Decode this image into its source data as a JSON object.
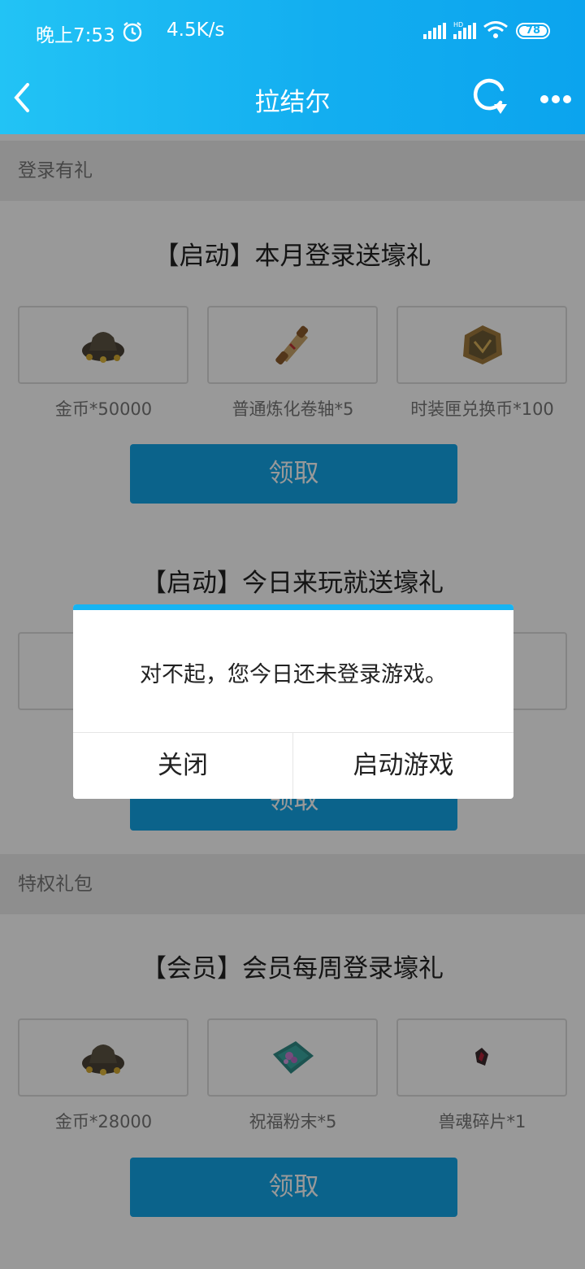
{
  "status_bar": {
    "time": "晚上7:53",
    "speed": "4.5K/s",
    "battery": "78",
    "icons": [
      "alarm-icon",
      "signal-icon",
      "hd-signal-icon",
      "wifi-icon",
      "battery-icon"
    ]
  },
  "nav": {
    "title": "拉结尔",
    "icons": [
      "back-icon",
      "refresh-icon",
      "more-icon"
    ]
  },
  "sections": [
    {
      "title": "登录有礼",
      "cards": [
        {
          "title": "【启动】本月登录送壕礼",
          "items": [
            {
              "label": "金币*50000",
              "icon": "gold-bag-icon"
            },
            {
              "label": "普通炼化卷轴*5",
              "icon": "scroll-icon"
            },
            {
              "label": "时装匣兑换币*100",
              "icon": "coin-token-icon"
            }
          ],
          "button": "领取"
        },
        {
          "title": "【启动】今日来玩就送壕礼",
          "button": "领取"
        }
      ]
    },
    {
      "title": "特权礼包",
      "cards": [
        {
          "title": "【会员】会员每周登录壕礼",
          "items": [
            {
              "label": "金币*28000",
              "icon": "gold-bag-icon"
            },
            {
              "label": "祝福粉末*5",
              "icon": "blessing-powder-icon"
            },
            {
              "label": "兽魂碎片*1",
              "icon": "soul-fragment-icon"
            }
          ],
          "button": "领取"
        }
      ]
    }
  ],
  "dialog": {
    "message": "对不起，您今日还未登录游戏。",
    "close_label": "关闭",
    "launch_label": "启动游戏"
  },
  "colors": {
    "header": "#13aef0",
    "button": "#13a6e8",
    "dialog_accent": "#17b4f2"
  }
}
